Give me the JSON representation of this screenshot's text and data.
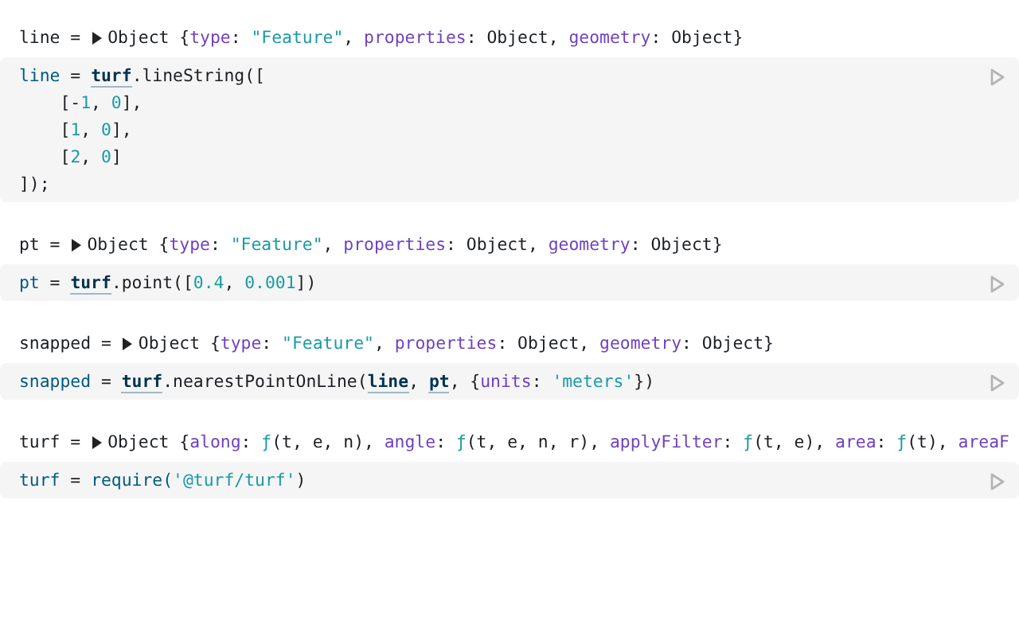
{
  "cells": [
    {
      "output": {
        "name": "line =",
        "summary": [
          {
            "text": "Object {",
            "kind": "plain"
          },
          {
            "text": "type",
            "kind": "key"
          },
          {
            "text": ": ",
            "kind": "plain"
          },
          {
            "text": "\"Feature\"",
            "kind": "string"
          },
          {
            "text": ", ",
            "kind": "plain"
          },
          {
            "text": "properties",
            "kind": "key"
          },
          {
            "text": ": Object, ",
            "kind": "plain"
          },
          {
            "text": "geometry",
            "kind": "key"
          },
          {
            "text": ": Object}",
            "kind": "plain"
          }
        ]
      },
      "code": [
        [
          {
            "text": "line",
            "kind": "def"
          },
          {
            "text": " = ",
            "kind": "plain"
          },
          {
            "text": "turf",
            "kind": "ref"
          },
          {
            "text": ".lineString([",
            "kind": "plain"
          }
        ],
        [
          {
            "text": "    [-",
            "kind": "plain"
          },
          {
            "text": "1",
            "kind": "number"
          },
          {
            "text": ", ",
            "kind": "plain"
          },
          {
            "text": "0",
            "kind": "number"
          },
          {
            "text": "],",
            "kind": "plain"
          }
        ],
        [
          {
            "text": "    [",
            "kind": "plain"
          },
          {
            "text": "1",
            "kind": "number"
          },
          {
            "text": ", ",
            "kind": "plain"
          },
          {
            "text": "0",
            "kind": "number"
          },
          {
            "text": "],",
            "kind": "plain"
          }
        ],
        [
          {
            "text": "    [",
            "kind": "plain"
          },
          {
            "text": "2",
            "kind": "number"
          },
          {
            "text": ", ",
            "kind": "plain"
          },
          {
            "text": "0",
            "kind": "number"
          },
          {
            "text": "]",
            "kind": "plain"
          }
        ],
        [
          {
            "text": "]);",
            "kind": "plain"
          }
        ]
      ]
    },
    {
      "output": {
        "name": "pt =",
        "summary": [
          {
            "text": "Object {",
            "kind": "plain"
          },
          {
            "text": "type",
            "kind": "key"
          },
          {
            "text": ": ",
            "kind": "plain"
          },
          {
            "text": "\"Feature\"",
            "kind": "string"
          },
          {
            "text": ", ",
            "kind": "plain"
          },
          {
            "text": "properties",
            "kind": "key"
          },
          {
            "text": ": Object, ",
            "kind": "plain"
          },
          {
            "text": "geometry",
            "kind": "key"
          },
          {
            "text": ": Object}",
            "kind": "plain"
          }
        ]
      },
      "code": [
        [
          {
            "text": "pt",
            "kind": "def"
          },
          {
            "text": " = ",
            "kind": "plain"
          },
          {
            "text": "turf",
            "kind": "ref"
          },
          {
            "text": ".point([",
            "kind": "plain"
          },
          {
            "text": "0.4",
            "kind": "number"
          },
          {
            "text": ", ",
            "kind": "plain"
          },
          {
            "text": "0.001",
            "kind": "number"
          },
          {
            "text": "])",
            "kind": "plain"
          }
        ]
      ]
    },
    {
      "output": {
        "name": "snapped =",
        "summary": [
          {
            "text": "Object {",
            "kind": "plain"
          },
          {
            "text": "type",
            "kind": "key"
          },
          {
            "text": ": ",
            "kind": "plain"
          },
          {
            "text": "\"Feature\"",
            "kind": "string"
          },
          {
            "text": ", ",
            "kind": "plain"
          },
          {
            "text": "properties",
            "kind": "key"
          },
          {
            "text": ": Object, ",
            "kind": "plain"
          },
          {
            "text": "geometry",
            "kind": "key"
          },
          {
            "text": ": Object}",
            "kind": "plain"
          }
        ]
      },
      "code": [
        [
          {
            "text": "snapped",
            "kind": "def"
          },
          {
            "text": " = ",
            "kind": "plain"
          },
          {
            "text": "turf",
            "kind": "ref"
          },
          {
            "text": ".nearestPointOnLine(",
            "kind": "plain"
          },
          {
            "text": "line",
            "kind": "ref"
          },
          {
            "text": ", ",
            "kind": "plain"
          },
          {
            "text": "pt",
            "kind": "ref"
          },
          {
            "text": ", {",
            "kind": "plain"
          },
          {
            "text": "units",
            "kind": "key"
          },
          {
            "text": ": ",
            "kind": "plain"
          },
          {
            "text": "'meters'",
            "kind": "string"
          },
          {
            "text": "})",
            "kind": "plain"
          }
        ]
      ]
    },
    {
      "output": {
        "name": "turf =",
        "summary": [
          {
            "text": "Object {",
            "kind": "plain"
          },
          {
            "text": "along",
            "kind": "key"
          },
          {
            "text": ": ",
            "kind": "plain"
          },
          {
            "text": "ƒ",
            "kind": "string"
          },
          {
            "text": "(t, e, n), ",
            "kind": "plain"
          },
          {
            "text": "angle",
            "kind": "key"
          },
          {
            "text": ": ",
            "kind": "plain"
          },
          {
            "text": "ƒ",
            "kind": "string"
          },
          {
            "text": "(t, e, n, r), ",
            "kind": "plain"
          },
          {
            "text": "applyFilter",
            "kind": "key"
          },
          {
            "text": ": ",
            "kind": "plain"
          },
          {
            "text": "ƒ",
            "kind": "string"
          },
          {
            "text": "(t, e), ",
            "kind": "plain"
          },
          {
            "text": "area",
            "kind": "key"
          },
          {
            "text": ": ",
            "kind": "plain"
          },
          {
            "text": "ƒ",
            "kind": "string"
          },
          {
            "text": "(t), ",
            "kind": "plain"
          },
          {
            "text": "areaF",
            "kind": "key"
          }
        ]
      },
      "code": [
        [
          {
            "text": "turf",
            "kind": "def"
          },
          {
            "text": " = ",
            "kind": "plain"
          },
          {
            "text": "require(",
            "kind": "fn"
          },
          {
            "text": "'@turf/turf'",
            "kind": "string"
          },
          {
            "text": ")",
            "kind": "plain"
          }
        ]
      ]
    }
  ]
}
